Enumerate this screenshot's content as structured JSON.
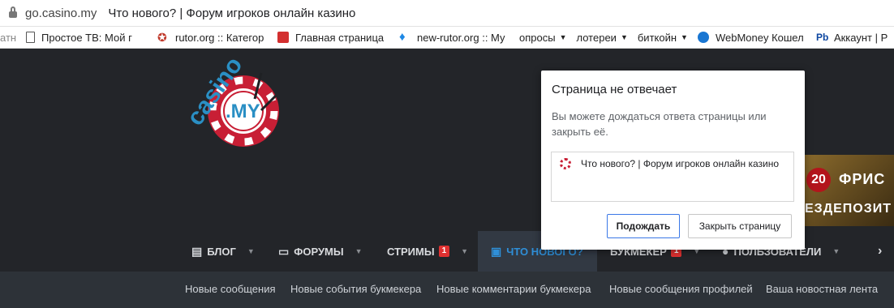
{
  "browser": {
    "url": "go.casino.my",
    "title": "Что нового? | Форум игроков онлайн казино"
  },
  "bookmarks": [
    {
      "label": "атн",
      "icon": "text-fragment",
      "color": "#888888"
    },
    {
      "label": "Простое ТВ: Мой г",
      "icon": "page-icon",
      "color": "#555555"
    },
    {
      "label": "rutor.org :: Категор",
      "icon": "star-icon",
      "color": "#c0392b"
    },
    {
      "label": "Главная страница",
      "icon": "news-icon",
      "color": "#d32f2f"
    },
    {
      "label": "new-rutor.org :: Му",
      "icon": "pin-icon",
      "color": "#1e88e5"
    },
    {
      "label": "опросы",
      "icon": "folder-icon",
      "color": "#444444",
      "dropdown": true
    },
    {
      "label": "лотереи",
      "icon": "folder-icon",
      "color": "#444444",
      "dropdown": true
    },
    {
      "label": "биткойн",
      "icon": "folder-icon",
      "color": "#444444",
      "dropdown": true
    },
    {
      "label": "WebMoney Кошел",
      "icon": "globe-icon",
      "color": "#1976d2"
    },
    {
      "label": "Аккаунт | Р",
      "icon": "pb-icon",
      "color": "#0d47a1"
    }
  ],
  "logo": {
    "word": "casino",
    "domain": ".MY",
    "color_main": "#2a8fc4",
    "color_chip": "#c81f35"
  },
  "banner": {
    "number": "20",
    "line1": "ФРИС",
    "line2": "ЕЗДЕПОЗИТ"
  },
  "nav": {
    "items": [
      {
        "label": "БЛОГ",
        "icon": "blog-icon",
        "dropdown": true
      },
      {
        "label": "ФОРУМЫ",
        "icon": "forum-icon",
        "dropdown": true
      },
      {
        "label": "СТРИМЫ",
        "badge": "1",
        "dropdown": true
      },
      {
        "label": "ЧТО НОВОГО?",
        "icon": "whats-new-icon",
        "active": true
      },
      {
        "label": "БУКМЕКЕР",
        "badge": "1",
        "dropdown": true
      },
      {
        "label": "ПОЛЬЗОВАТЕЛИ",
        "icon": "users-icon",
        "dropdown": true
      }
    ],
    "more": "›"
  },
  "subnav": [
    "Новые сообщения",
    "Новые события букмекера",
    "Новые комментарии букмекера",
    "Новые сообщения профилей",
    "Ваша новостная лента"
  ],
  "dialog": {
    "title": "Страница не отвечает",
    "message": "Вы можете дождаться ответа страницы или закрыть её.",
    "tab_title": "Что нового? | Форум игроков онлайн казино",
    "wait_button": "Подождать",
    "close_button": "Закрыть страницу"
  },
  "colors": {
    "accent": "#2f8fd8",
    "badge": "#e03131",
    "bg": "#232529",
    "subnav_bg": "#2d3238"
  }
}
